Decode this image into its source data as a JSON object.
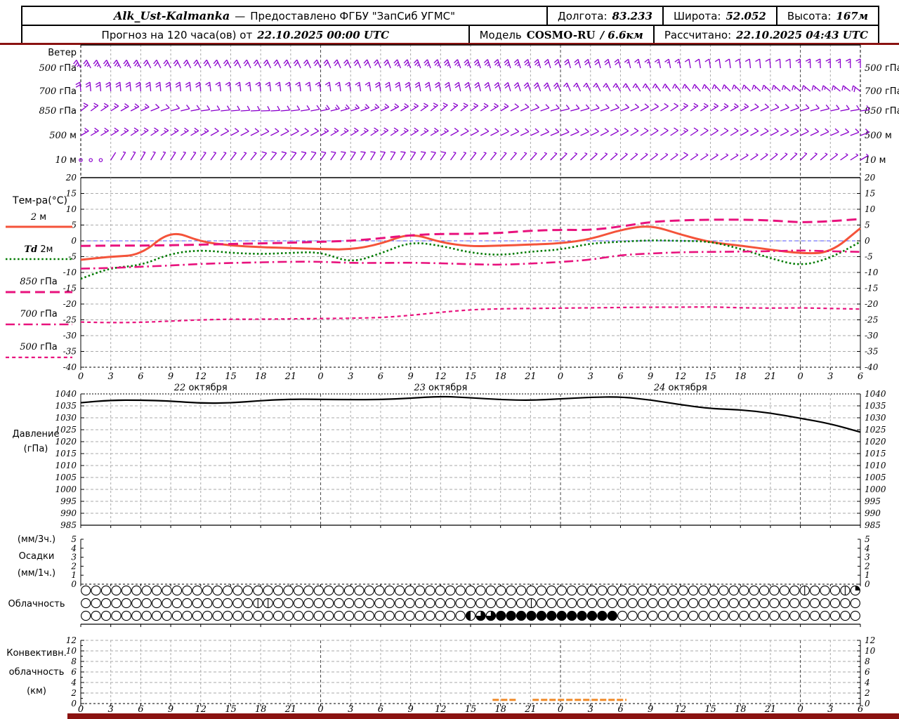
{
  "header": {
    "station": "Alk_Ust-Kalmanka",
    "dash": "—",
    "provider": "Предоставлено ФГБУ \"ЗапСиб УГМС\"",
    "lon_label": "Долгота:",
    "lon_value": "83.233",
    "lat_label": "Широта:",
    "lat_value": "52.052",
    "alt_label": "Высота:",
    "alt_value": "167м",
    "forecast_prefix": "Прогноз на 120 часа(ов) от",
    "forecast_time": "22.10.2025 00:00 UTC",
    "model_label": "Модель",
    "model_name": "COSMO-RU",
    "model_res": "/ 6.6км",
    "calc_label": "Рассчитано:",
    "calc_value": "22.10.2025 04:43 UTC"
  },
  "colors": {
    "accent_bar": "#8a1210",
    "barb": "#8a00cc",
    "temp_2m": "#f4533a",
    "dewpoint": "#007a00",
    "magenta": "#e8127d",
    "pressure": "#000000",
    "convective": "#f08a28",
    "grid": "#aaaaaa",
    "day_grid": "#444444",
    "zero_line": "#5050ff"
  },
  "axis": {
    "hours_span": 78,
    "hour_label_step": 3,
    "dates": [
      {
        "num": "22",
        "word": "октября",
        "center_h": 12
      },
      {
        "num": "23",
        "word": "октября",
        "center_h": 36
      },
      {
        "num": "24",
        "word": "октября",
        "center_h": 60
      }
    ]
  },
  "chart_data": [
    {
      "id": "wind",
      "type": "wind-barbs",
      "title": "Ветер",
      "levels": [
        {
          "num": "500",
          "unit": "гПа"
        },
        {
          "num": "700",
          "unit": "гПа"
        },
        {
          "num": "850",
          "unit": "гПа"
        },
        {
          "num": "500",
          "unit": "м"
        },
        {
          "num": "10",
          "unit": "м"
        }
      ],
      "anchor_step_hours": 6,
      "rows": [
        {
          "dirs": [
            118,
            117,
            116,
            115,
            114,
            112,
            110,
            108,
            106,
            104,
            100,
            96,
            92,
            90
          ],
          "spds": [
            25,
            25,
            22,
            20,
            20,
            24,
            28,
            28,
            24,
            20,
            15,
            12,
            15,
            18
          ]
        },
        {
          "dirs": [
            95,
            95,
            96,
            96,
            97,
            98,
            100,
            105,
            112,
            120,
            128,
            135,
            140,
            142
          ],
          "spds": [
            20,
            20,
            20,
            18,
            18,
            20,
            22,
            22,
            20,
            18,
            15,
            15,
            18,
            20
          ]
        },
        {
          "dirs": [
            38,
            25,
            8,
            2,
            12,
            25,
            40,
            30,
            14,
            22,
            35,
            28,
            18,
            8
          ],
          "spds": [
            15,
            15,
            12,
            12,
            15,
            18,
            18,
            15,
            12,
            12,
            15,
            15,
            12,
            10
          ]
        },
        {
          "dirs": [
            30,
            34,
            30,
            26,
            30,
            34,
            30,
            26,
            22,
            30,
            34,
            30,
            26,
            20
          ],
          "spds": [
            15,
            18,
            15,
            12,
            15,
            18,
            15,
            12,
            10,
            12,
            15,
            12,
            10,
            10
          ]
        },
        {
          "dirs": [
            55,
            60,
            55,
            50,
            55,
            60,
            55,
            50,
            45,
            40,
            35,
            32,
            45,
            30
          ],
          "spds": [
            0,
            8,
            8,
            10,
            10,
            12,
            10,
            8,
            8,
            8,
            10,
            8,
            8,
            6
          ]
        }
      ]
    },
    {
      "id": "temperature",
      "type": "line",
      "title": "Тем-ра(°C)",
      "ylim": [
        -40,
        20
      ],
      "yticks": [
        20,
        15,
        10,
        5,
        0,
        -5,
        -10,
        -15,
        -20,
        -25,
        -30,
        -35,
        -40
      ],
      "x_step_hours": 3,
      "zero_line": 0,
      "series": [
        {
          "name": "2м",
          "style": "solid",
          "color": "#f4533a",
          "width": 3,
          "values": [
            -6.0,
            -5.0,
            -4.5,
            3.4,
            -0.3,
            -1.5,
            -2.0,
            -2.3,
            -2.6,
            -2.8,
            -1.0,
            2.5,
            -0.5,
            -1.8,
            -1.5,
            -1.2,
            -0.8,
            0.5,
            3.5,
            5.0,
            2.0,
            -0.5,
            -1.5,
            -2.8,
            -4.0,
            -3.8,
            4.0
          ]
        },
        {
          "name": "Td 2м",
          "style": "dotted",
          "color": "#007a00",
          "width": 2.6,
          "values": [
            -12.0,
            -8.5,
            -7.8,
            -4.0,
            -2.9,
            -3.8,
            -4.2,
            -3.8,
            -3.5,
            -7.0,
            -4.0,
            -0.3,
            -1.5,
            -3.8,
            -4.6,
            -3.4,
            -2.8,
            -0.8,
            -0.3,
            0.2,
            0.0,
            -0.2,
            -2.5,
            -5.5,
            -8.0,
            -5.5,
            -0.3
          ]
        },
        {
          "name": "850 гПа",
          "style": "longdash",
          "color": "#e8127d",
          "width": 3,
          "values": [
            -1.6,
            -1.5,
            -1.5,
            -1.4,
            -1.2,
            -1.0,
            -0.8,
            -0.6,
            -0.3,
            0.0,
            0.8,
            1.8,
            2.2,
            2.2,
            2.5,
            3.2,
            3.5,
            3.4,
            4.5,
            6.0,
            6.5,
            6.7,
            6.7,
            6.5,
            5.8,
            6.2,
            6.9
          ]
        },
        {
          "name": "700 гПа",
          "style": "dashdot",
          "color": "#e8127d",
          "width": 2.6,
          "values": [
            -8.8,
            -8.6,
            -8.2,
            -7.8,
            -7.3,
            -7.0,
            -6.8,
            -6.6,
            -6.6,
            -7.0,
            -7.0,
            -6.9,
            -7.1,
            -7.4,
            -7.6,
            -7.2,
            -6.7,
            -6.0,
            -4.5,
            -4.0,
            -3.6,
            -3.5,
            -3.4,
            -3.3,
            -3.0,
            -3.3,
            -3.5
          ]
        },
        {
          "name": "500 гПа",
          "style": "shortdash",
          "color": "#e8127d",
          "width": 2.2,
          "values": [
            -25.7,
            -25.9,
            -25.8,
            -25.4,
            -25.0,
            -24.8,
            -24.8,
            -24.7,
            -24.6,
            -24.5,
            -24.3,
            -23.6,
            -22.6,
            -21.8,
            -21.5,
            -21.4,
            -21.3,
            -21.2,
            -21.1,
            -21.0,
            -21.0,
            -20.9,
            -21.2,
            -21.3,
            -21.2,
            -21.4,
            -21.6
          ]
        }
      ]
    },
    {
      "id": "pressure",
      "type": "line",
      "title": "Давление",
      "unit": "(гПа)",
      "ylim": [
        985,
        1040
      ],
      "yticks": [
        1040,
        1035,
        1030,
        1025,
        1020,
        1015,
        1010,
        1005,
        1000,
        995,
        990,
        985
      ],
      "x_step_hours": 3,
      "color": "#000000",
      "values": [
        1036.3,
        1037.4,
        1037.4,
        1037.0,
        1036.1,
        1036.2,
        1037.2,
        1037.8,
        1037.7,
        1037.6,
        1037.6,
        1038.2,
        1039.0,
        1038.4,
        1037.6,
        1037.3,
        1037.9,
        1038.6,
        1038.8,
        1037.5,
        1035.5,
        1033.8,
        1033.4,
        1032.0,
        1029.8,
        1027.5,
        1024.0
      ]
    },
    {
      "id": "precip",
      "type": "bar",
      "title": "Осадки",
      "unit_top": "(мм/3ч.)",
      "unit_bottom": "(мм/1ч.)",
      "ylim": [
        0,
        5
      ],
      "yticks": [
        5,
        4,
        3,
        2,
        1,
        0
      ],
      "values": []
    },
    {
      "id": "cloud",
      "type": "cloud-cover",
      "title": "Облачность",
      "circles_per_row": 77,
      "rows": [
        "00000000000000000000000000000000000000000000000000000000000000000000000100015",
        "00000000000000000110000000000000000000000000100000000000000000000000000000000",
        "00000000000000000000000000000000000000233444444444444000000000000000000000000"
      ]
    },
    {
      "id": "convective",
      "type": "segments",
      "title_lines": [
        "Конвективн.",
        "облачность",
        "(км)"
      ],
      "ylim": [
        0,
        12
      ],
      "yticks": [
        12,
        10,
        8,
        6,
        4,
        2,
        0
      ],
      "segments": [
        {
          "from_h": 41.2,
          "to_h": 43.6,
          "top_km": 0.7
        },
        {
          "from_h": 45.2,
          "to_h": 54.6,
          "top_km": 0.7
        }
      ],
      "color": "#f08a28"
    }
  ]
}
